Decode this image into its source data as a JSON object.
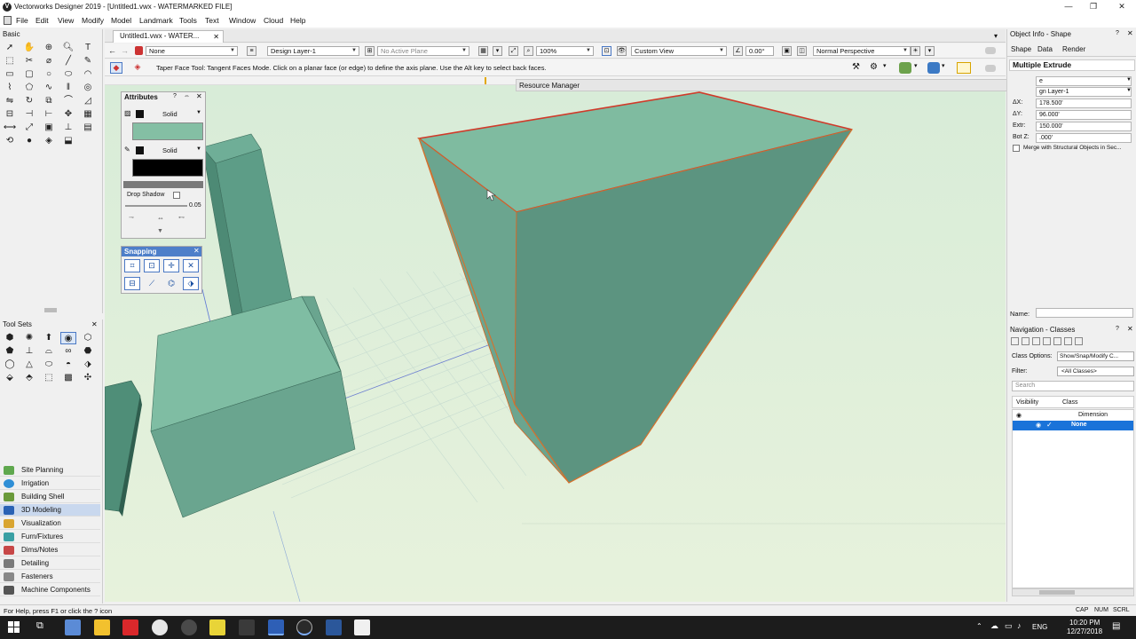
{
  "window": {
    "title": "Vectorworks Designer 2019 - [Untitled1.vwx - WATERMARKED FILE]",
    "logo_letter": "V"
  },
  "menu": [
    "File",
    "Edit",
    "View",
    "Modify",
    "Model",
    "Landmark",
    "Tools",
    "Text",
    "Window",
    "Cloud",
    "Help"
  ],
  "document_tab": "Untitled1.vwx - WATER...",
  "viewbar": {
    "class": "None",
    "layer": "Design Layer-1",
    "plane": "No Active Plane",
    "zoom": "100%",
    "view": "Custom View",
    "angle": "0.00°",
    "render": "Normal Perspective"
  },
  "modebar": {
    "hint": "Taper Face Tool: Tangent Faces Mode. Click on a planar face (or edge) to define the axis plane.  Use the Alt key to select back faces."
  },
  "resource_manager": {
    "title": "Resource Manager",
    "help": "?",
    "pin": "⇔",
    "close": "✕"
  },
  "basic_palette": {
    "title": "Basic"
  },
  "attributes": {
    "title": "Attributes",
    "help": "?",
    "pin": "⇔",
    "close": "✕",
    "fill_style": "Solid",
    "pen_style": "Solid",
    "fill_color": "#84bfa4",
    "pen_color": "#000000",
    "drop_shadow_label": "Drop Shadow",
    "opacity": "0.05"
  },
  "snapping": {
    "title": "Snapping",
    "close": "✕"
  },
  "toolsets": {
    "title": "Tool Sets",
    "close": "✕",
    "items": [
      {
        "label": "Site Planning",
        "color": "#5fa84e"
      },
      {
        "label": "Irrigation",
        "color": "#2f8fd6"
      },
      {
        "label": "Building Shell",
        "color": "#6a9a3a"
      },
      {
        "label": "3D Modeling",
        "color": "#2a62b4"
      },
      {
        "label": "Visualization",
        "color": "#d9a530"
      },
      {
        "label": "Furn/Fixtures",
        "color": "#3aa0a4"
      },
      {
        "label": "Dims/Notes",
        "color": "#c74747"
      },
      {
        "label": "Detailing",
        "color": "#7a7a7a"
      },
      {
        "label": "Fasteners",
        "color": "#888888"
      },
      {
        "label": "Machine Components",
        "color": "#555555"
      }
    ],
    "active_index": 3
  },
  "object_info": {
    "title": "Object Info - Shape",
    "help": "?",
    "close": "✕",
    "tabs": [
      "Shape",
      "Data",
      "Render"
    ],
    "object_type": "Multiple Extrude",
    "class_value": "e",
    "layer_value": "gn Layer-1",
    "fields": [
      {
        "label": "ΔX:",
        "value": "178.500'"
      },
      {
        "label": "ΔY:",
        "value": "96.000'"
      },
      {
        "label": "Extr:",
        "value": "150.000'"
      },
      {
        "label": "Bot Z:",
        "value": ".000'"
      }
    ],
    "merge_label": "Merge with Structural Objects in Sec...",
    "name_label": "Name:"
  },
  "navigation": {
    "title": "Navigation - Classes",
    "help": "?",
    "close": "✕",
    "class_options_label": "Class Options:",
    "class_options_value": "Show/Snap/Modify C...",
    "filter_label": "Filter:",
    "filter_value": "<All Classes>",
    "search_placeholder": "Search",
    "col_visibility": "Visibility",
    "col_class": "Class",
    "rows": [
      {
        "name": "Dimension",
        "selected": false
      },
      {
        "name": "None",
        "selected": true
      }
    ]
  },
  "status": {
    "help": "For Help, press F1 or click the ? icon",
    "keys": [
      "CAP",
      "NUM",
      "SCRL"
    ]
  },
  "taskbar": {
    "lang": "ENG",
    "time": "10:20 PM",
    "date": "12/27/2018"
  }
}
